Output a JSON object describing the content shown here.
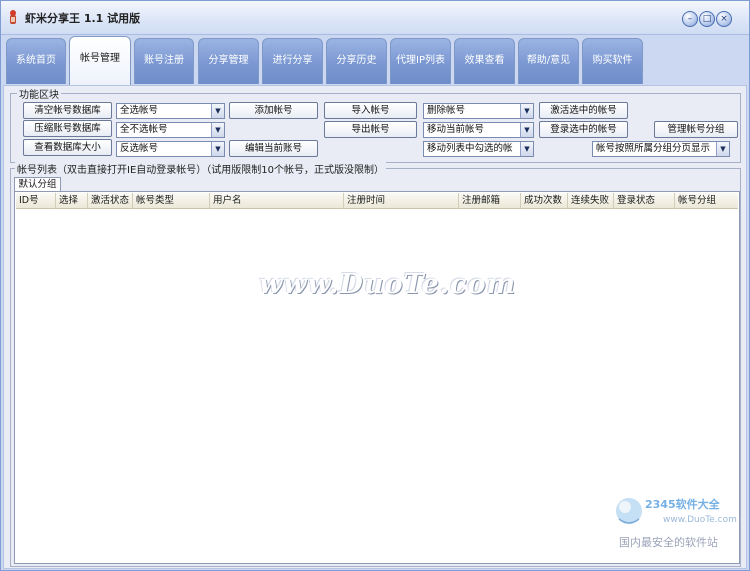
{
  "app": {
    "title": "虾米分享王 1.1 试用版",
    "controls": {
      "minimize": "–",
      "maximize": "□",
      "close": "×"
    }
  },
  "tabs": [
    {
      "label": "系统首页",
      "active": false
    },
    {
      "label": "帐号管理",
      "active": true
    },
    {
      "label": "账号注册",
      "active": false
    },
    {
      "label": "分享管理",
      "active": false
    },
    {
      "label": "进行分享",
      "active": false
    },
    {
      "label": "分享历史",
      "active": false
    },
    {
      "label": "代理IP列表",
      "active": false
    },
    {
      "label": "效果查看",
      "active": false
    },
    {
      "label": "帮助/意见",
      "active": false
    },
    {
      "label": "购买软件",
      "active": false
    }
  ],
  "function_block": {
    "label": "功能区块",
    "buttons": {
      "clear_db": "清空帐号数据库",
      "compress_db": "压缩账号数据库",
      "view_db_size": "查看数据库大小",
      "add_account": "添加帐号",
      "edit_account": "编辑当前账号",
      "import_accounts": "导入帐号",
      "export_accounts": "导出帐号",
      "activate_selected": "激活选中的帐号",
      "login_selected": "登录选中的帐号",
      "manage_groups": "管理帐号分组"
    },
    "combos": {
      "select_all": "全选帐号",
      "select_none": "全不选帐号",
      "invert_select": "反选帐号",
      "delete_accounts": "删除帐号",
      "move_current": "移动当前帐号",
      "move_checked": "移动列表中勾选的帐",
      "group_display": "帐号按照所属分组分页显示"
    }
  },
  "account_list": {
    "label": "帐号列表（双击直接打开IE自动登录帐号）（试用版限制10个帐号，正式版没限制）",
    "group_tab": "默认分组",
    "columns": [
      "ID号",
      "选择",
      "激活状态",
      "帐号类型",
      "用户名",
      "注册时间",
      "注册邮箱",
      "成功次数",
      "连续失败",
      "登录状态",
      "帐号分组"
    ]
  },
  "watermark": "www.DuoTe.com",
  "branding": {
    "logo_text": "2345软件大全",
    "logo_url": "www.DuoTe.com",
    "caption": "国内最安全的软件站"
  }
}
